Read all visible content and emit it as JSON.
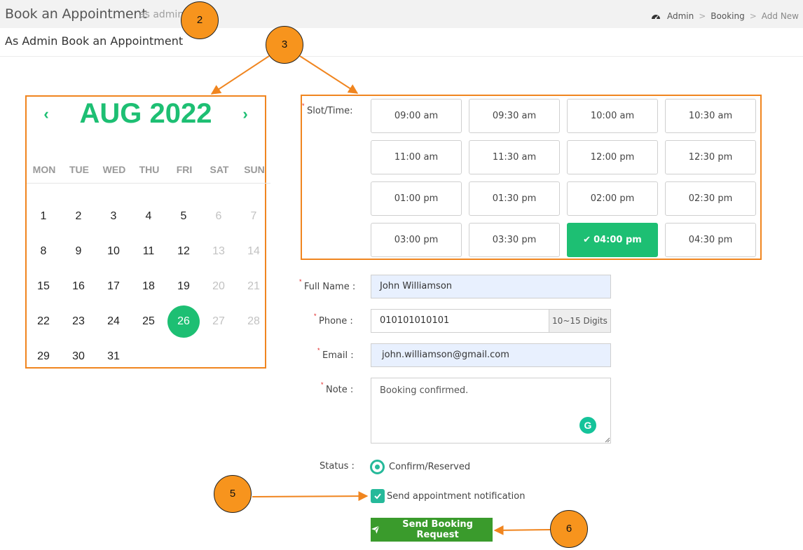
{
  "header": {
    "title": "Book an Appointment",
    "subtitle": "as admin",
    "breadcrumb": [
      "Admin",
      "Booking",
      "Add New"
    ],
    "section_heading": "As Admin Book an Appointment"
  },
  "calendar": {
    "month_label": "AUG 2022",
    "prev_icon": "chevron-left-icon",
    "next_icon": "chevron-right-icon",
    "weekdays": [
      "MON",
      "TUE",
      "WED",
      "THU",
      "FRI",
      "SAT",
      "SUN"
    ],
    "weeks": [
      [
        "1",
        "2",
        "3",
        "4",
        "5",
        "6",
        "7"
      ],
      [
        "8",
        "9",
        "10",
        "11",
        "12",
        "13",
        "14"
      ],
      [
        "15",
        "16",
        "17",
        "18",
        "19",
        "20",
        "21"
      ],
      [
        "22",
        "23",
        "24",
        "25",
        "26",
        "27",
        "28"
      ],
      [
        "29",
        "30",
        "31",
        "",
        "",
        "",
        ""
      ]
    ],
    "selected_day": "26",
    "accent_color": "#1dbf73"
  },
  "slots": {
    "label": "Slot/Time:",
    "times": [
      "09:00 am",
      "09:30 am",
      "10:00 am",
      "10:30 am",
      "11:00 am",
      "11:30 am",
      "12:00 pm",
      "12:30 pm",
      "01:00 pm",
      "01:30 pm",
      "02:00 pm",
      "02:30 pm",
      "03:00 pm",
      "03:30 pm",
      "04:00 pm",
      "04:30 pm"
    ],
    "selected": "04:00 pm"
  },
  "form": {
    "full_name_label": "Full Name :",
    "full_name_value": "John Williamson",
    "phone_label": "Phone :",
    "phone_value": "010101010101",
    "phone_hint": "10~15 Digits",
    "email_label": "Email :",
    "email_value": "john.williamson@gmail.com",
    "note_label": "Note :",
    "note_value": "Booking confirmed.",
    "status_label": "Status :",
    "status_value": "Confirm/Reserved",
    "notify_label": "Send appointment notification",
    "submit_label": "Send Booking Request"
  },
  "callouts": [
    "2",
    "3",
    "5",
    "6"
  ],
  "colors": {
    "annotation_border": "#f0851f",
    "callout_fill": "#f7941d",
    "submit_button": "#3a9b2c",
    "toggle_teal": "#26b99a"
  }
}
